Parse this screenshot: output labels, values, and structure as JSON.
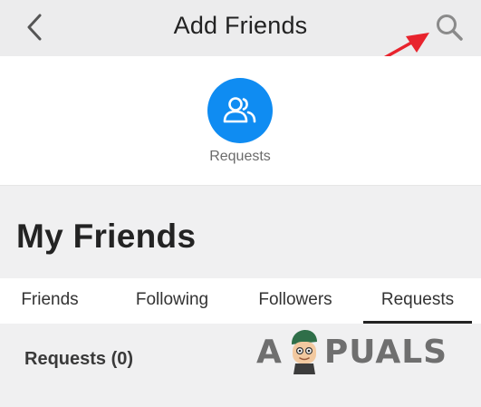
{
  "header": {
    "title": "Add Friends",
    "back_icon": "chevron-left-icon",
    "search_icon": "search-icon"
  },
  "annotation": {
    "arrow_color": "#e8232d"
  },
  "quick_actions": [
    {
      "label": "Requests",
      "icon": "friends-icon",
      "color": "#0f8cf2"
    }
  ],
  "section": {
    "title": "My Friends"
  },
  "tabs": [
    {
      "label": "Friends",
      "active": false
    },
    {
      "label": "Following",
      "active": false
    },
    {
      "label": "Followers",
      "active": false
    },
    {
      "label": "Requests",
      "active": true
    }
  ],
  "content": {
    "requests_heading": "Requests (0)"
  },
  "watermark": {
    "left": "A",
    "right": "PUALS"
  }
}
